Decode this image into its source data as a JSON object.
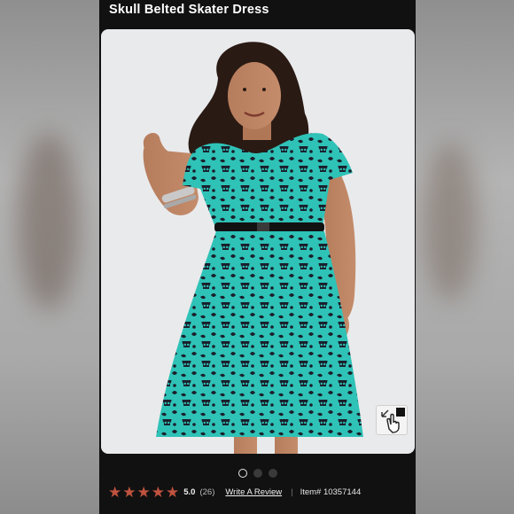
{
  "product": {
    "title": "Skull Belted Skater Dress"
  },
  "gallery": {
    "image_alt_icon": "model-photo",
    "dots": [
      {
        "state": "active"
      },
      {
        "state": "inactive"
      },
      {
        "state": "inactive"
      }
    ],
    "zoom_icon": "zoom-hand-icon"
  },
  "rating": {
    "stars": 5,
    "value": "5.0",
    "count": "(26)",
    "write_review": "Write A Review",
    "separator": "|",
    "item_number": "Item# 10357144"
  },
  "colors": {
    "dress": "#2fc2b7",
    "pattern": "#1a1f2b",
    "star": "#c0533f",
    "background": "#111111"
  }
}
